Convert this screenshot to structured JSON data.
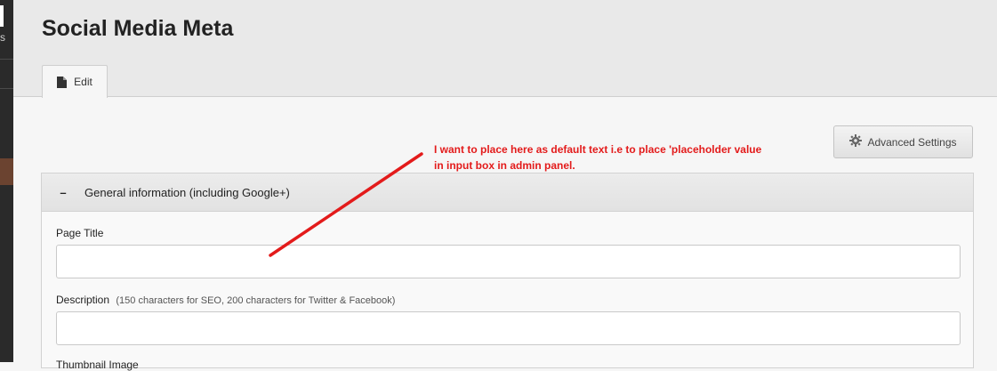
{
  "page": {
    "title": "Social Media Meta"
  },
  "tabs": [
    {
      "label": "Edit",
      "icon": "document-icon"
    }
  ],
  "toolbar": {
    "advanced_settings_label": "Advanced Settings",
    "advanced_settings_icon": "gear-icon"
  },
  "annotation": {
    "line1": "I want to place here as default text i.e to place 'placeholder value",
    "line2": "in input box in admin panel.",
    "color": "#e31b1b"
  },
  "panel": {
    "toggle_symbol": "–",
    "title": "General information (including Google+)",
    "fields": [
      {
        "label": "Page Title",
        "hint": "",
        "value": "",
        "placeholder": ""
      },
      {
        "label": "Description",
        "hint": "(150 characters for SEO, 200 characters for Twitter & Facebook)",
        "value": "",
        "placeholder": ""
      }
    ],
    "next_field_label_partial": "Thumbnail Image"
  }
}
